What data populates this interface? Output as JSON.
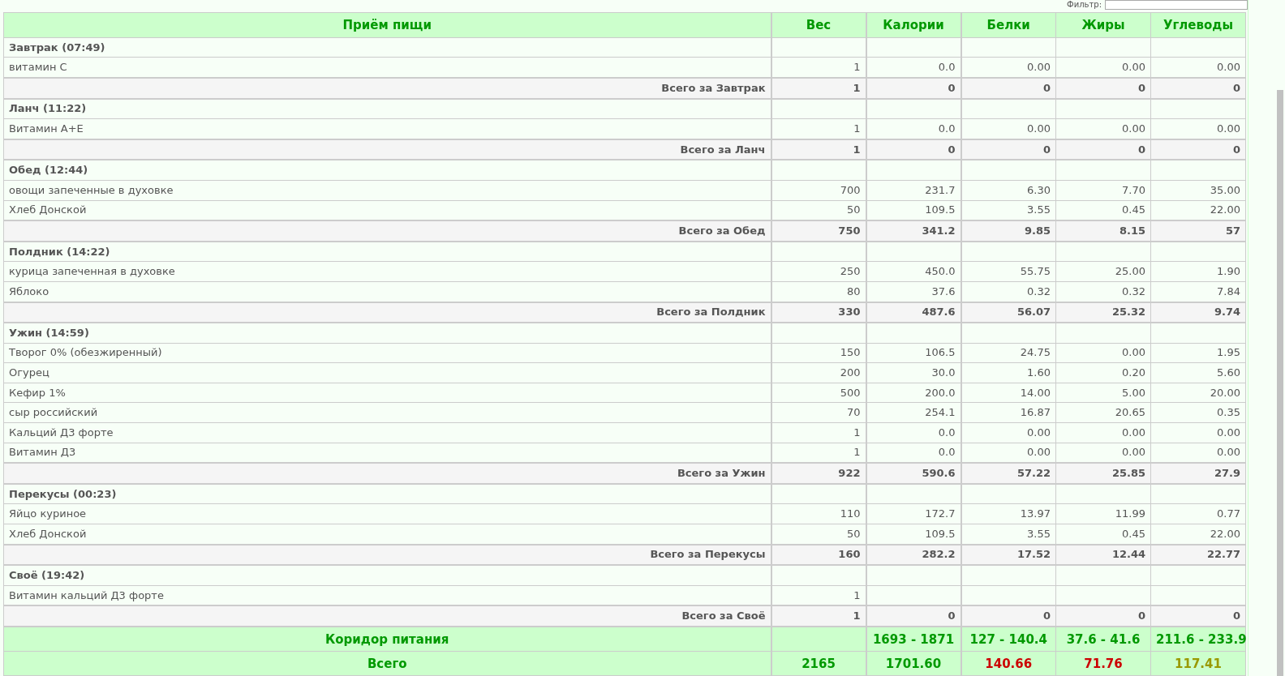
{
  "filter": {
    "label": "Фильтр:"
  },
  "table": {
    "columns": [
      "Приём пищи",
      "Вес",
      "Калории",
      "Белки",
      "Жиры",
      "Углеводы"
    ],
    "meals": [
      {
        "title": "Завтрак (07:49)",
        "items": [
          {
            "name": "витамин C",
            "values": [
              "1",
              "0.0",
              "0.00",
              "0.00",
              "0.00"
            ]
          }
        ],
        "total": {
          "label": "Всего за Завтрак",
          "values": [
            "1",
            "0",
            "0",
            "0",
            "0"
          ]
        }
      },
      {
        "title": "Ланч (11:22)",
        "items": [
          {
            "name": "Витамин А+Е",
            "values": [
              "1",
              "0.0",
              "0.00",
              "0.00",
              "0.00"
            ]
          }
        ],
        "total": {
          "label": "Всего за Ланч",
          "values": [
            "1",
            "0",
            "0",
            "0",
            "0"
          ]
        }
      },
      {
        "title": "Обед (12:44)",
        "items": [
          {
            "name": "овощи запеченные в духовке",
            "values": [
              "700",
              "231.7",
              "6.30",
              "7.70",
              "35.00"
            ]
          },
          {
            "name": "Хлеб Донской",
            "values": [
              "50",
              "109.5",
              "3.55",
              "0.45",
              "22.00"
            ]
          }
        ],
        "total": {
          "label": "Всего за Обед",
          "values": [
            "750",
            "341.2",
            "9.85",
            "8.15",
            "57"
          ]
        }
      },
      {
        "title": "Полдник (14:22)",
        "items": [
          {
            "name": "курица запеченная в духовке",
            "values": [
              "250",
              "450.0",
              "55.75",
              "25.00",
              "1.90"
            ]
          },
          {
            "name": "Яблоко",
            "values": [
              "80",
              "37.6",
              "0.32",
              "0.32",
              "7.84"
            ]
          }
        ],
        "total": {
          "label": "Всего за Полдник",
          "values": [
            "330",
            "487.6",
            "56.07",
            "25.32",
            "9.74"
          ]
        }
      },
      {
        "title": "Ужин (14:59)",
        "items": [
          {
            "name": "Творог 0% (обезжиренный)",
            "values": [
              "150",
              "106.5",
              "24.75",
              "0.00",
              "1.95"
            ]
          },
          {
            "name": "Огурец",
            "values": [
              "200",
              "30.0",
              "1.60",
              "0.20",
              "5.60"
            ]
          },
          {
            "name": "Кефир 1%",
            "values": [
              "500",
              "200.0",
              "14.00",
              "5.00",
              "20.00"
            ]
          },
          {
            "name": "сыр российский",
            "values": [
              "70",
              "254.1",
              "16.87",
              "20.65",
              "0.35"
            ]
          },
          {
            "name": "Кальций Д3 форте",
            "values": [
              "1",
              "0.0",
              "0.00",
              "0.00",
              "0.00"
            ]
          },
          {
            "name": "Витамин Д3",
            "values": [
              "1",
              "0.0",
              "0.00",
              "0.00",
              "0.00"
            ]
          }
        ],
        "total": {
          "label": "Всего за Ужин",
          "values": [
            "922",
            "590.6",
            "57.22",
            "25.85",
            "27.9"
          ]
        }
      },
      {
        "title": "Перекусы (00:23)",
        "items": [
          {
            "name": "Яйцо куриное",
            "values": [
              "110",
              "172.7",
              "13.97",
              "11.99",
              "0.77"
            ]
          },
          {
            "name": "Хлеб Донской",
            "values": [
              "50",
              "109.5",
              "3.55",
              "0.45",
              "22.00"
            ]
          }
        ],
        "total": {
          "label": "Всего за Перекусы",
          "values": [
            "160",
            "282.2",
            "17.52",
            "12.44",
            "22.77"
          ]
        }
      },
      {
        "title": "Своё (19:42)",
        "items": [
          {
            "name": "Витамин кальций Д3 форте",
            "values": [
              "1"
            ]
          }
        ],
        "total": {
          "label": "Всего за Своё",
          "values": [
            "1",
            "0",
            "0",
            "0",
            "0"
          ]
        }
      }
    ],
    "corridor": {
      "label": "Коридор питания",
      "ranges": [
        "1693 - 1871",
        "127 - 140.4",
        "37.6 - 41.6",
        "211.6 - 233.9"
      ]
    },
    "grand_total": {
      "label": "Всего",
      "values": [
        {
          "text": "2165",
          "color": "#009900"
        },
        {
          "text": "1701.60",
          "color": "#009900"
        },
        {
          "text": "140.66",
          "color": "#cc0000"
        },
        {
          "text": "71.76",
          "color": "#cc0000"
        },
        {
          "text": "117.41",
          "color": "#999900"
        }
      ]
    }
  }
}
